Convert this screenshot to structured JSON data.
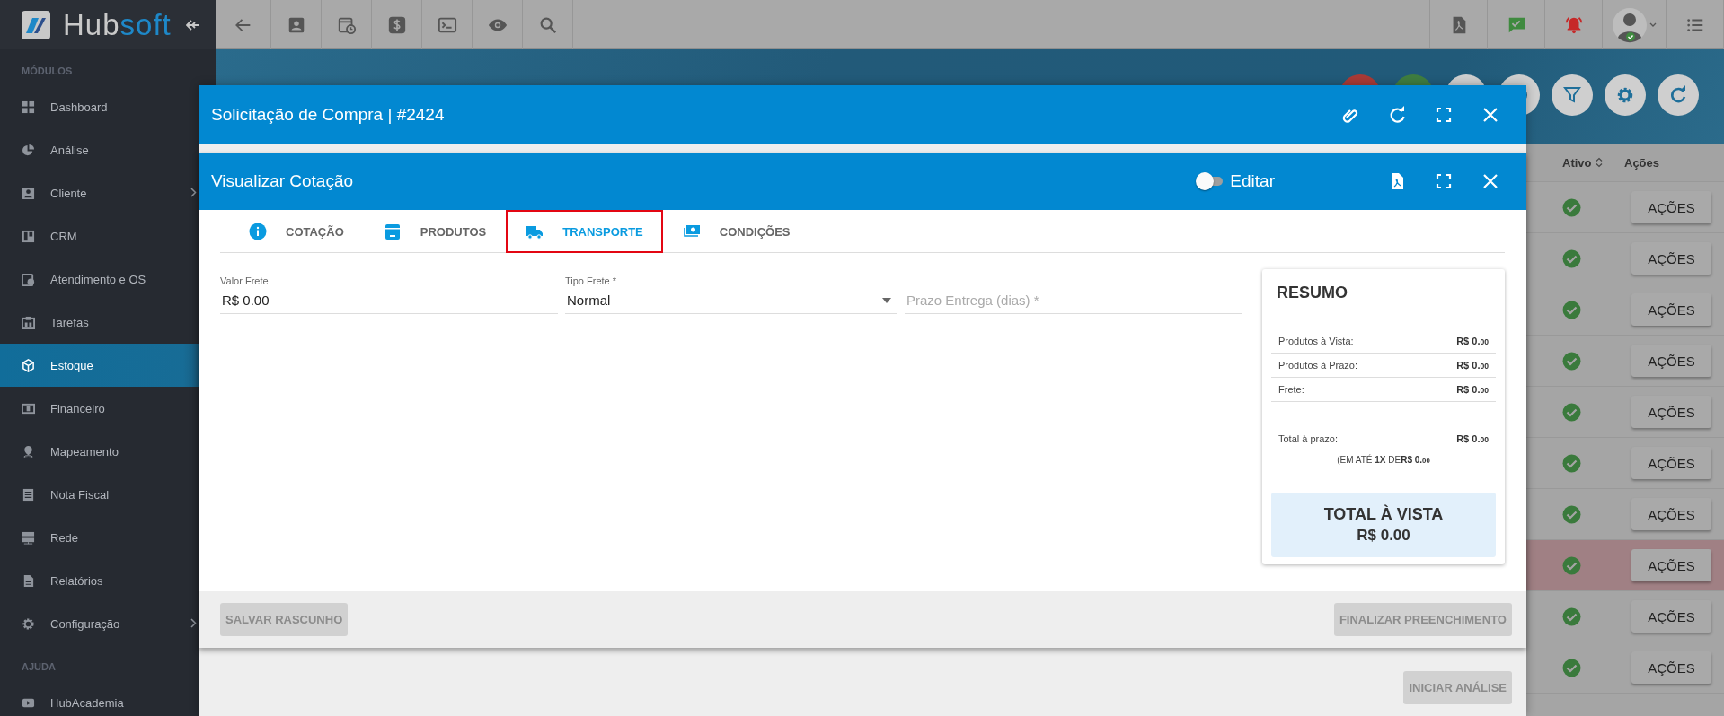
{
  "sidebar": {
    "logo": {
      "text": "Hub",
      "accent": "soft"
    },
    "sections": [
      {
        "title": "MÓDULOS",
        "items": [
          {
            "label": "Dashboard",
            "selected": false,
            "has_submenu": false
          },
          {
            "label": "Análise",
            "selected": false,
            "has_submenu": false
          },
          {
            "label": "Cliente",
            "selected": false,
            "has_submenu": true
          },
          {
            "label": "CRM",
            "selected": false,
            "has_submenu": false
          },
          {
            "label": "Atendimento e OS",
            "selected": false,
            "has_submenu": false
          },
          {
            "label": "Tarefas",
            "selected": false,
            "has_submenu": false
          },
          {
            "label": "Estoque",
            "selected": true,
            "has_submenu": false
          },
          {
            "label": "Financeiro",
            "selected": false,
            "has_submenu": false
          },
          {
            "label": "Mapeamento",
            "selected": false,
            "has_submenu": false
          },
          {
            "label": "Nota Fiscal",
            "selected": false,
            "has_submenu": false
          },
          {
            "label": "Rede",
            "selected": false,
            "has_submenu": false
          },
          {
            "label": "Relatórios",
            "selected": false,
            "has_submenu": false
          },
          {
            "label": "Configuração",
            "selected": false,
            "has_submenu": true
          }
        ]
      },
      {
        "title": "AJUDA",
        "items": [
          {
            "label": "HubAcademia",
            "selected": false,
            "has_submenu": false
          }
        ]
      }
    ]
  },
  "page": {
    "table": {
      "columns": [
        "Ativo",
        "Ações"
      ],
      "rows": [
        {
          "active": true,
          "highlighted": false,
          "action": "AÇÕES"
        },
        {
          "active": true,
          "highlighted": false,
          "action": "AÇÕES"
        },
        {
          "active": true,
          "highlighted": false,
          "action": "AÇÕES"
        },
        {
          "active": true,
          "highlighted": false,
          "action": "AÇÕES"
        },
        {
          "active": true,
          "highlighted": false,
          "action": "AÇÕES"
        },
        {
          "active": true,
          "highlighted": false,
          "action": "AÇÕES"
        },
        {
          "active": true,
          "highlighted": false,
          "action": "AÇÕES"
        },
        {
          "active": true,
          "highlighted": true,
          "action": "AÇÕES"
        },
        {
          "active": true,
          "highlighted": false,
          "action": "AÇÕES"
        },
        {
          "active": true,
          "highlighted": false,
          "action": "AÇÕES"
        }
      ]
    }
  },
  "outer_dialog": {
    "title": "Solicitação de Compra | #2424",
    "footer_button": {
      "label": "INICIAR ANÁLISE",
      "disabled": true
    }
  },
  "dialog": {
    "title": "Visualizar Cotação",
    "edit_toggle": {
      "label": "Editar",
      "on": false
    },
    "tabs": [
      {
        "label": "COTAÇÃO",
        "selected": false
      },
      {
        "label": "PRODUTOS",
        "selected": false
      },
      {
        "label": "TRANSPORTE",
        "selected": true
      },
      {
        "label": "CONDIÇÕES",
        "selected": false
      }
    ],
    "fields": [
      {
        "kind": "text",
        "label": "Valor Frete",
        "value": "R$ 0.00"
      },
      {
        "kind": "select",
        "label": "Tipo Frete *",
        "value": "Normal"
      },
      {
        "kind": "text",
        "placeholder": "Prazo Entrega (dias) *"
      }
    ],
    "summary": {
      "title": "RESUMO",
      "rows": [
        {
          "label": "Produtos à Vista:",
          "amount": "R$ 0.",
          "cents": "00"
        },
        {
          "label": "Produtos à Prazo:",
          "amount": "R$ 0.",
          "cents": "00"
        },
        {
          "label": "Frete:",
          "amount": "R$ 0.",
          "cents": "00"
        }
      ],
      "total_term": {
        "label": "Total à prazo:",
        "amount": "R$ 0.",
        "cents": "00"
      },
      "installments": {
        "text": "(EM ATÉ **1X** DE",
        "amount": "R$ 0.",
        "cents": "00"
      },
      "total_cash": {
        "label": "TOTAL À VISTA",
        "amount": "R$ 0.",
        "cents": "00"
      }
    },
    "buttons": [
      {
        "label": "SALVAR RASCUNHO",
        "disabled": true
      },
      {
        "label": "FINALIZAR PREENCHIMENTO",
        "disabled": true
      }
    ]
  }
}
